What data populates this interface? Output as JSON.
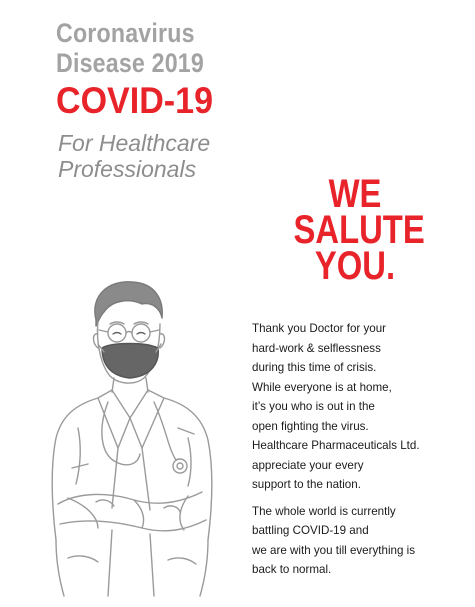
{
  "header": {
    "line1": "Coronavirus",
    "line2": "Disease 2019",
    "line3": "COVID-19"
  },
  "subtitle": {
    "line1": "For Healthcare",
    "line2": "Professionals"
  },
  "salute": {
    "line1": "WE",
    "line2": "SALUTE",
    "line3": "YOU."
  },
  "message": {
    "paragraph1": "Thank you Doctor for your\nhard-work & selflessness\nduring this time of crisis.\nWhile everyone is at home,\nit’s you who is out in the\nopen fighting the virus.\nHealthcare Pharmaceuticals Ltd.\nappreciate your every\nsupport to the nation.",
    "paragraph2": "The whole world is currently\nbattling COVID-19 and\nwe are with you till everything is\nback to normal."
  },
  "colors": {
    "accent_red": "#e8232a",
    "heading_grey": "#a3a3a3",
    "subtitle_grey": "#8d8d8d",
    "text": "#1b1b1b"
  },
  "illustration": {
    "icon": "doctor-with-mask-icon"
  }
}
